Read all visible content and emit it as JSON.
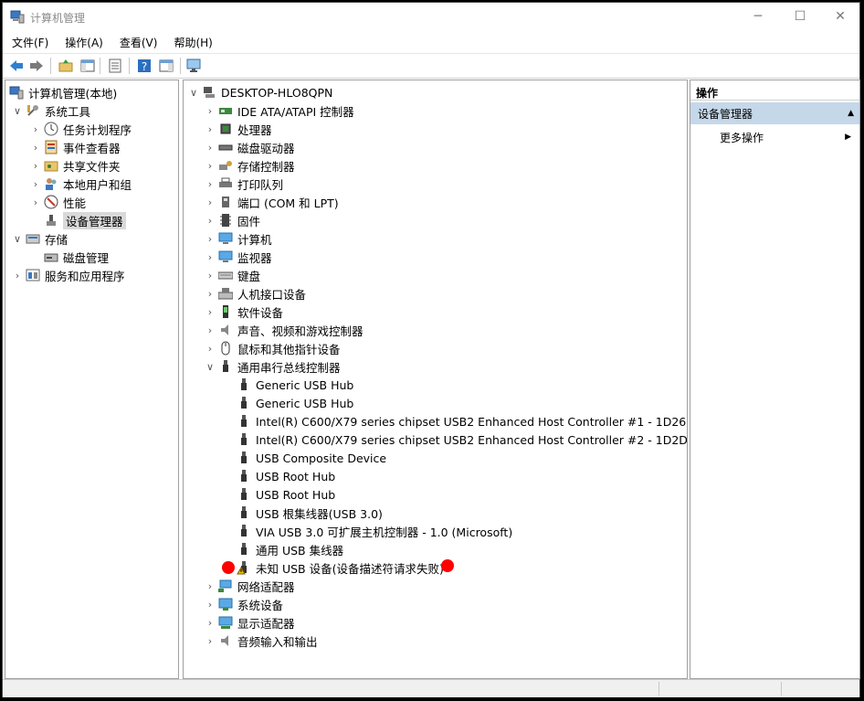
{
  "window": {
    "title": "计算机管理"
  },
  "menu": [
    "文件(F)",
    "操作(A)",
    "查看(V)",
    "帮助(H)"
  ],
  "toolbar": [
    "back-icon",
    "forward-icon",
    "up-folder-icon",
    "show-hide-tree-icon",
    "properties-icon",
    "help-icon",
    "action-pane-icon",
    "monitor-icon"
  ],
  "left_tree": [
    {
      "label": "计算机管理(本地)",
      "icon": "computer-mgmt-icon"
    },
    {
      "label": "系统工具",
      "icon": "tools-icon"
    },
    {
      "label": "任务计划程序",
      "icon": "clock-icon"
    },
    {
      "label": "事件查看器",
      "icon": "event-viewer-icon"
    },
    {
      "label": "共享文件夹",
      "icon": "shared-folder-icon"
    },
    {
      "label": "本地用户和组",
      "icon": "users-icon"
    },
    {
      "label": "性能",
      "icon": "performance-icon"
    },
    {
      "label": "设备管理器",
      "icon": "device-manager-icon"
    },
    {
      "label": "存储",
      "icon": "storage-icon"
    },
    {
      "label": "磁盘管理",
      "icon": "disk-mgmt-icon"
    },
    {
      "label": "服务和应用程序",
      "icon": "services-icon"
    }
  ],
  "device_tree": {
    "root": "DESKTOP-HLO8QPN",
    "categories": [
      "IDE ATA/ATAPI 控制器",
      "处理器",
      "磁盘驱动器",
      "存储控制器",
      "打印队列",
      "端口 (COM 和 LPT)",
      "固件",
      "计算机",
      "监视器",
      "键盘",
      "人机接口设备",
      "软件设备",
      "声音、视频和游戏控制器",
      "鼠标和其他指针设备",
      "通用串行总线控制器"
    ],
    "usb_children": [
      "Generic USB Hub",
      "Generic USB Hub",
      "Intel(R) C600/X79 series chipset USB2 Enhanced Host Controller #1 - 1D26",
      "Intel(R) C600/X79 series chipset USB2 Enhanced Host Controller #2 - 1D2D",
      "USB Composite Device",
      "USB Root Hub",
      "USB Root Hub",
      "USB 根集线器(USB 3.0)",
      "VIA USB 3.0 可扩展主机控制器 - 1.0 (Microsoft)",
      "通用 USB 集线器",
      "未知 USB 设备(设备描述符请求失败)"
    ],
    "after_categories": [
      "网络适配器",
      "系统设备",
      "显示适配器",
      "音频输入和输出"
    ]
  },
  "actions": {
    "header": "操作",
    "group": "设备管理器",
    "item": "更多操作"
  },
  "colors": {
    "action_group_bg": "#c5d8ea",
    "marker": "#ff0000",
    "selected_bg": "#d9d9d9"
  }
}
